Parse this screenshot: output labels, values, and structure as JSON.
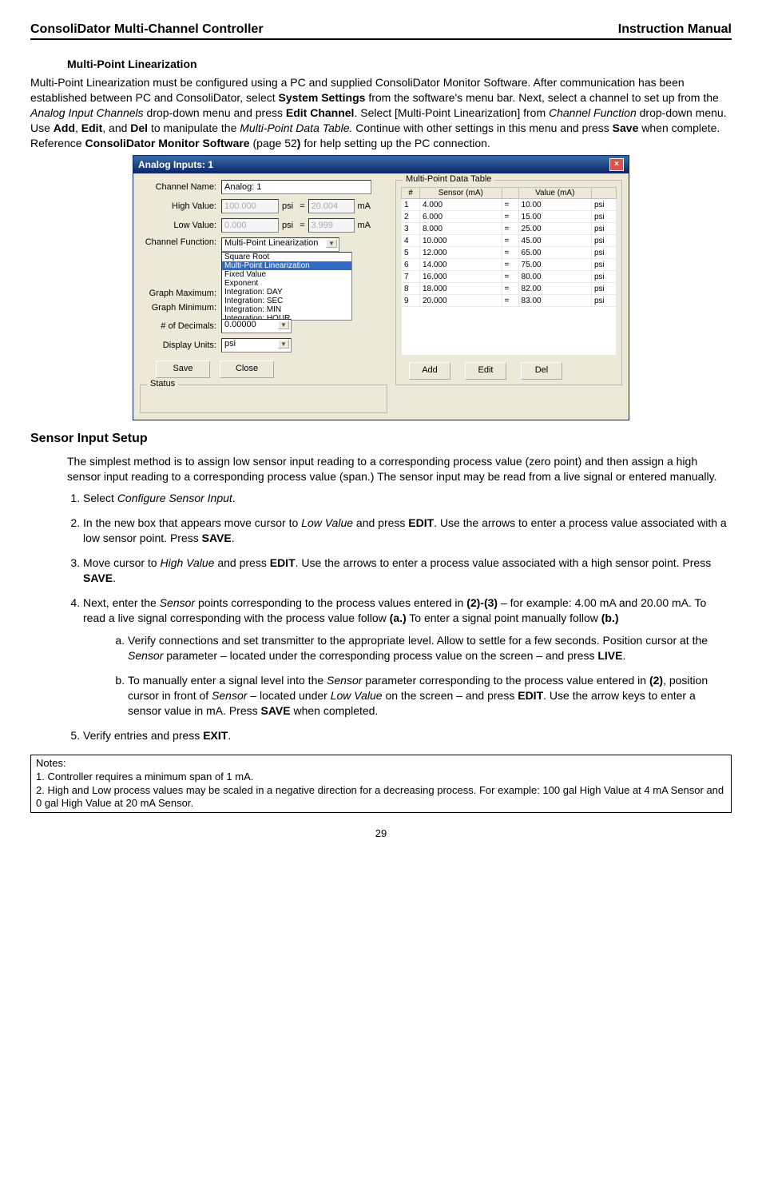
{
  "header": {
    "left": "ConsoliDator Multi-Channel Controller",
    "right": "Instruction Manual"
  },
  "section1": {
    "title": "Multi-Point Linearization",
    "para": "Multi-Point Linearization must be configured using a PC and supplied ConsoliDator Monitor Software. After communication has been established between PC and ConsoliDator, select ",
    "para_b1": "System Settings",
    "para2": " from the software's menu bar. Next, select a channel to set up from the ",
    "para_i1": "Analog Input Channels",
    "para3": " drop-down menu and press ",
    "para_b2": "Edit Channel",
    "para4": ". Select [Multi-Point Linearization] from ",
    "para_i2": "Channel Function",
    "para5": " drop-down menu. Use ",
    "para_b3": "Add",
    "comma1": ", ",
    "para_b4": "Edit",
    "comma2": ", and ",
    "para_b5": "Del",
    "para6": " to manipulate the ",
    "para_i3": "Multi-Point Data Table.",
    "para7": " Continue with other settings in this menu and press ",
    "para_b6": "Save",
    "para8": " when complete. Reference ",
    "para_b7": "ConsoliDator Monitor Software",
    "para9": " (page 52",
    "para_b8": ")",
    "para10": " for help setting up the PC connection."
  },
  "dialog": {
    "title": "Analog Inputs: 1",
    "labels": {
      "channelName": "Channel Name:",
      "highValue": "High Value:",
      "lowValue": "Low Value:",
      "channelFunc": "Channel Function:",
      "graphMax": "Graph Maximum:",
      "graphMin": "Graph Minimum:",
      "decimals": "# of Decimals:",
      "dispUnits": "Display Units:",
      "save": "Save",
      "close": "Close",
      "status": "Status"
    },
    "values": {
      "channelName": "Analog: 1",
      "highValue": "100.000",
      "highSensor": "20.004",
      "lowValue": "0.000",
      "lowSensor": "3.999",
      "psi": "psi",
      "eq": "=",
      "mA": "mA",
      "funcSelected": "Multi-Point Linearization",
      "listbox": [
        "Square Root",
        "Multi-Point Linearization",
        "Fixed Value",
        "Exponent",
        "Integration: DAY",
        "Integration: SEC",
        "Integration: MIN",
        "Integration: HOUR"
      ],
      "decimals": "0.00000",
      "units": "psi"
    },
    "table": {
      "group": "Multi-Point Data Table",
      "headers": [
        "#",
        "Sensor (mA)",
        "",
        "Value (mA)",
        ""
      ],
      "rows": [
        [
          "1",
          "4.000",
          "=",
          "10.00",
          "psi"
        ],
        [
          "2",
          "6.000",
          "=",
          "15.00",
          "psi"
        ],
        [
          "3",
          "8.000",
          "=",
          "25.00",
          "psi"
        ],
        [
          "4",
          "10.000",
          "=",
          "45.00",
          "psi"
        ],
        [
          "5",
          "12.000",
          "=",
          "65.00",
          "psi"
        ],
        [
          "6",
          "14.000",
          "=",
          "75.00",
          "psi"
        ],
        [
          "7",
          "16.000",
          "=",
          "80.00",
          "psi"
        ],
        [
          "8",
          "18.000",
          "=",
          "82.00",
          "psi"
        ],
        [
          "9",
          "20.000",
          "=",
          "83.00",
          "psi"
        ]
      ],
      "buttons": [
        "Add",
        "Edit",
        "Del"
      ]
    }
  },
  "section2": {
    "title": "Sensor Input Setup",
    "intro": "The simplest method is to assign low sensor input reading to a corresponding process value (zero point) and then assign a high sensor input reading to a corresponding process value (span.) The sensor input may be read from a live signal or entered manually.",
    "item1a": "Select ",
    "item1i": "Configure Sensor Input",
    "item1b": ".",
    "item2a": "In the new box that appears move cursor to ",
    "item2i": "Low Value",
    "item2b": " and press ",
    "item2bold": "EDIT",
    "item2c": ". Use the arrows to enter a process value associated with a low sensor point. Press ",
    "item2bold2": "SAVE",
    "item2d": ".",
    "item3a": "Move cursor to ",
    "item3i": "High Value",
    "item3b": " and press ",
    "item3bold": "EDIT",
    "item3c": ". Use the arrows to enter a process value associated with a high sensor point. Press ",
    "item3bold2": "SAVE",
    "item3d": ".",
    "item4a": "Next, enter the ",
    "item4i": "Sensor",
    "item4b": " points corresponding to the process values entered in ",
    "item4bold": "(2)-(3)",
    "item4c": " – for example: 4.00 mA and 20.00 mA. To read a live signal corresponding with the process value follow ",
    "item4bold2": "(a.)",
    "item4d": " To enter a signal point manually follow ",
    "item4bold3": "(b.)",
    "sub_a1": "Verify connections and set transmitter to the appropriate level. Allow to settle for a few seconds. Position cursor at the ",
    "sub_a_i": "Sensor",
    "sub_a2": " parameter – located under the corresponding process value on the screen – and press ",
    "sub_a_b": "LIVE",
    "sub_a3": ".",
    "sub_b1": "To manually enter a signal level into the ",
    "sub_b_i1": "Sensor",
    "sub_b2": " parameter corresponding to the process value entered in ",
    "sub_b_bold1": "(2)",
    "sub_b3": ", position cursor in front of ",
    "sub_b_i2": "Sensor",
    "sub_b4": " – located under ",
    "sub_b_i3": "Low Value",
    "sub_b5": " on the screen – and press ",
    "sub_b_bold2": "EDIT",
    "sub_b6": ". Use the arrow keys to enter a sensor value in mA. Press ",
    "sub_b_bold3": "SAVE",
    "sub_b7": " when completed.",
    "item5a": "Verify entries and press ",
    "item5bold": "EXIT",
    "item5b": "."
  },
  "notes": {
    "head": "Notes:",
    "n1": "1. Controller requires a minimum span of 1 mA.",
    "n2": "2. High and Low process values may be scaled in a negative direction for a decreasing process. For example: 100 gal High Value at 4 mA Sensor and 0 gal High Value at 20 mA Sensor."
  },
  "pagenum": "29"
}
